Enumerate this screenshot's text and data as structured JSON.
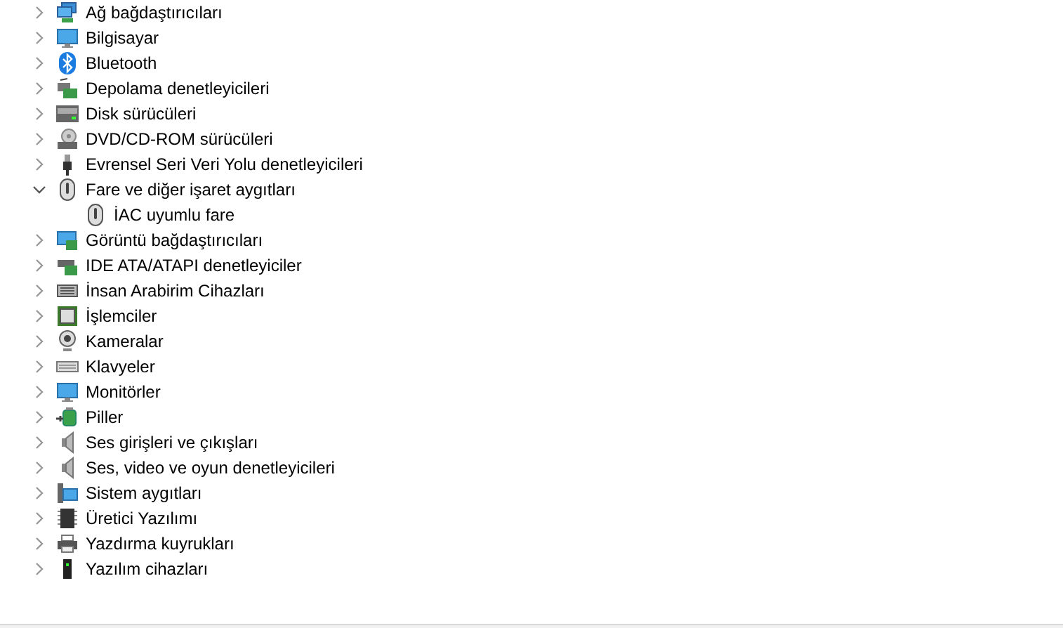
{
  "tree": [
    {
      "label": "Ağ bağdaştırıcıları",
      "expanded": false
    },
    {
      "label": "Bilgisayar",
      "expanded": false
    },
    {
      "label": "Bluetooth",
      "expanded": false
    },
    {
      "label": "Depolama denetleyicileri",
      "expanded": false
    },
    {
      "label": "Disk sürücüleri",
      "expanded": false
    },
    {
      "label": "DVD/CD-ROM sürücüleri",
      "expanded": false
    },
    {
      "label": "Evrensel Seri Veri Yolu denetleyicileri",
      "expanded": false
    },
    {
      "label": "Fare ve diğer işaret aygıtları",
      "expanded": true,
      "children": [
        {
          "label": "İAC uyumlu fare"
        }
      ]
    },
    {
      "label": "Görüntü bağdaştırıcıları",
      "expanded": false
    },
    {
      "label": "IDE ATA/ATAPI denetleyiciler",
      "expanded": false
    },
    {
      "label": "İnsan Arabirim Cihazları",
      "expanded": false
    },
    {
      "label": "İşlemciler",
      "expanded": false
    },
    {
      "label": "Kameralar",
      "expanded": false
    },
    {
      "label": "Klavyeler",
      "expanded": false
    },
    {
      "label": "Monitörler",
      "expanded": false
    },
    {
      "label": "Piller",
      "expanded": false
    },
    {
      "label": "Ses girişleri ve çıkışları",
      "expanded": false
    },
    {
      "label": "Ses, video ve oyun denetleyicileri",
      "expanded": false
    },
    {
      "label": "Sistem aygıtları",
      "expanded": false
    },
    {
      "label": "Üretici Yazılımı",
      "expanded": false
    },
    {
      "label": "Yazdırma kuyrukları",
      "expanded": false
    },
    {
      "label": "Yazılım cihazları",
      "expanded": false
    }
  ]
}
